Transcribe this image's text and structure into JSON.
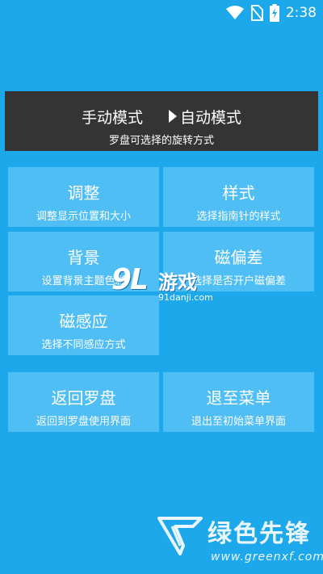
{
  "status_bar": {
    "time": "2:38",
    "icons": [
      "wifi-icon",
      "no-sim-icon",
      "battery-charging-icon"
    ]
  },
  "mode_panel": {
    "manual_label": "手动模式",
    "auto_label": "自动模式",
    "selected": "auto",
    "subtitle": "罗盘可选择的旋转方式"
  },
  "menu": {
    "adjust": {
      "title": "调整",
      "desc": "调整显示位置和大小"
    },
    "style": {
      "title": "样式",
      "desc": "选择指南针的样式"
    },
    "background": {
      "title": "背景",
      "desc": "设置背景主题色彩"
    },
    "magnetic_deviation": {
      "title": "磁偏差",
      "desc": "选择是否开户磁偏差"
    },
    "sensing": {
      "title": "磁感应",
      "desc": "选择不同感应方式"
    },
    "return_compass": {
      "title": "返回罗盘",
      "desc": "返回到罗盘使用界面"
    },
    "exit_menu": {
      "title": "退至菜单",
      "desc": "退出至初始菜单界面"
    }
  },
  "watermarks": {
    "mid_logo_num": "9L",
    "mid_logo_text": "游戏",
    "mid_url": "91danji.com",
    "bottom_text": "绿色先锋",
    "bottom_url": "www.greenxf.com"
  },
  "colors": {
    "background": "#1ea8ec",
    "tile": "#4fbef5",
    "mode_panel": "#343434",
    "text": "#ffffff"
  }
}
